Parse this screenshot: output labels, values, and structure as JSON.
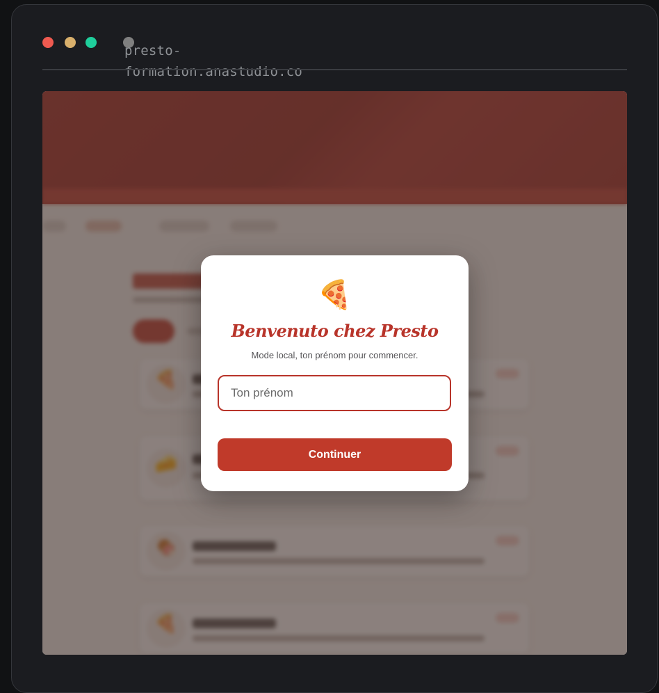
{
  "browser": {
    "url": "presto-formation.anastudio.co",
    "url_lines": [
      "presto-",
      "formation.anastudio.co"
    ]
  },
  "modal": {
    "icon": "pizza-icon",
    "icon_glyph": "🍕",
    "title": "Benvenuto chez Presto",
    "subtitle": "Mode local, ton prénom pour commencer.",
    "name_placeholder": "Ton prénom",
    "name_value": "",
    "continue_label": "Continuer"
  },
  "background_cards": [
    {
      "icon": "pizza-slice-icon",
      "glyph": "🍕"
    },
    {
      "icon": "cheese-icon",
      "glyph": "🧀"
    },
    {
      "icon": "meat-icon",
      "glyph": "🍖"
    },
    {
      "icon": "pizza-icon",
      "glyph": "🍕"
    }
  ],
  "colors": {
    "accent": "#c03a2a",
    "title_red": "#b8342a",
    "window_bg": "#1b1c20",
    "dot_red": "#ef5a50",
    "dot_yellow": "#d9b06c",
    "dot_green": "#1fcf9c"
  }
}
